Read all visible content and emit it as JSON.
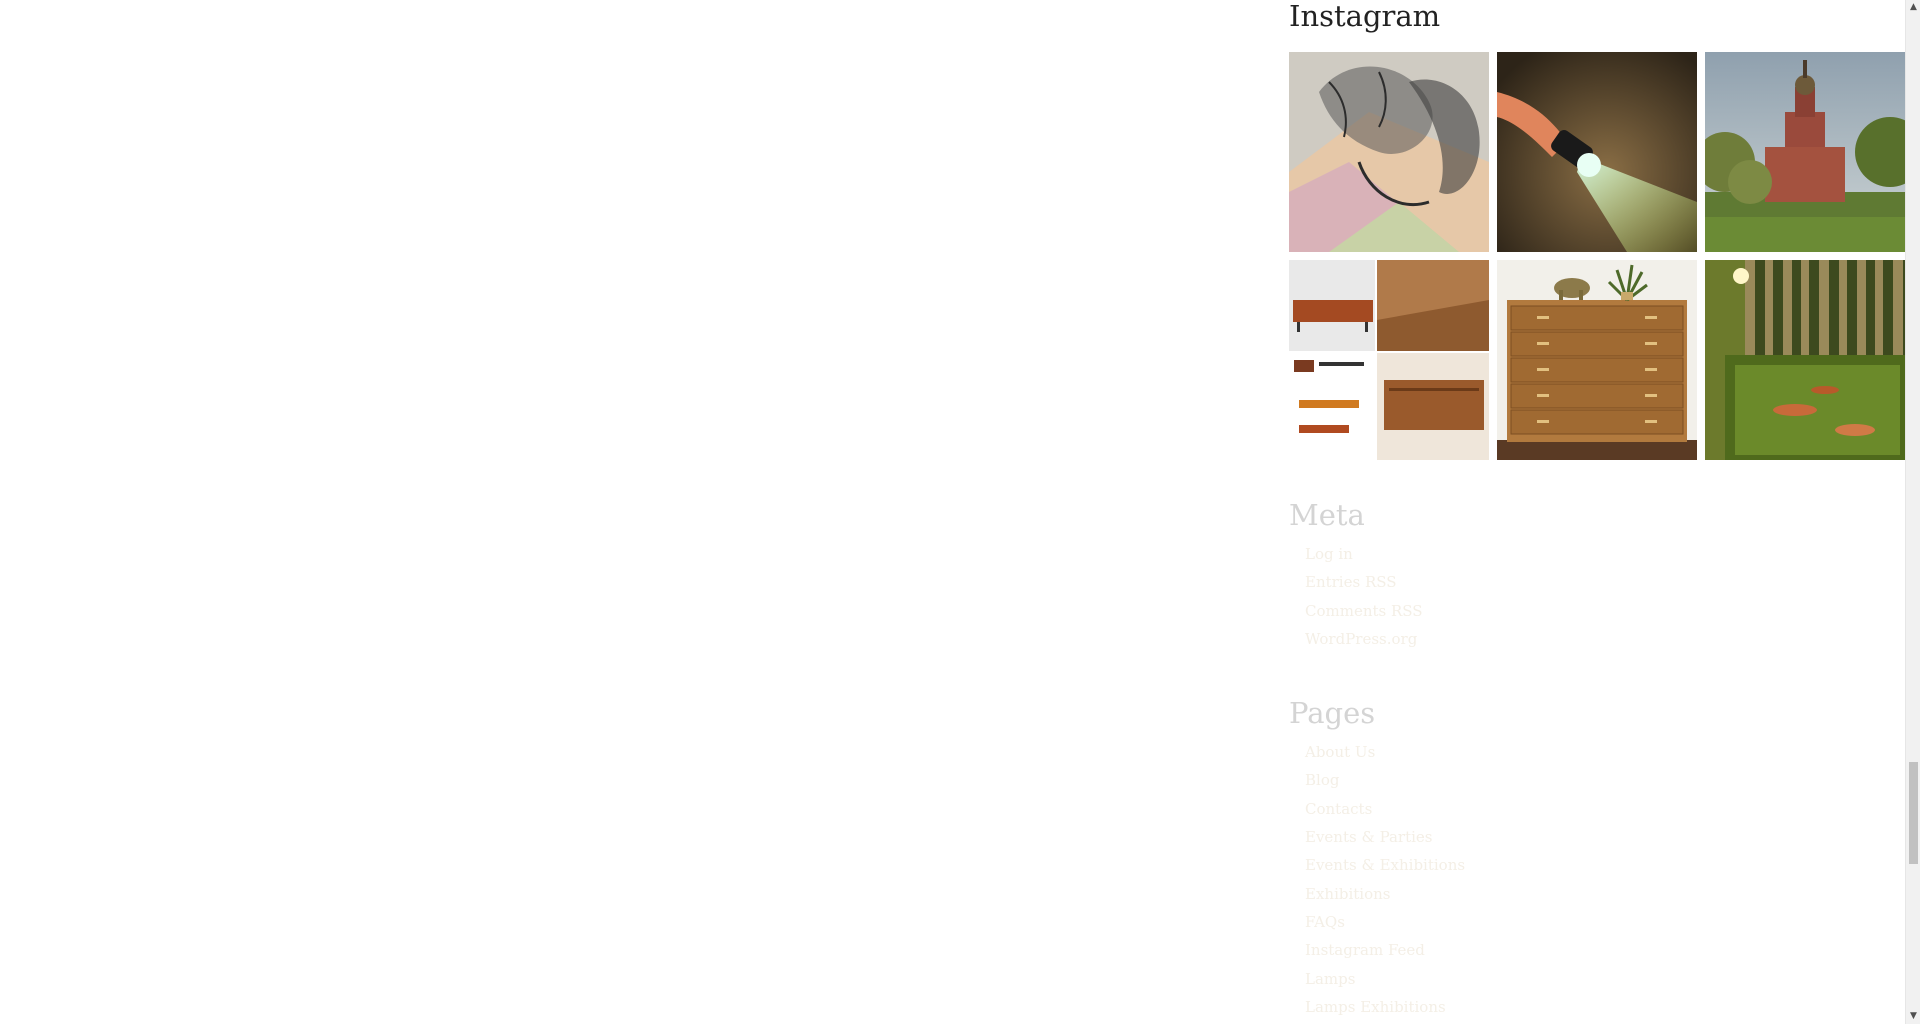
{
  "instagram": {
    "title": "Instagram",
    "tiles": [
      {
        "icon": "illustration-photo-icon"
      },
      {
        "icon": "flashlight-water-photo-icon"
      },
      {
        "icon": "church-photo-icon"
      },
      {
        "icon": "furniture-collage-photo-icon"
      },
      {
        "icon": "dresser-photo-icon"
      },
      {
        "icon": "pond-room-photo-icon"
      }
    ]
  },
  "meta": {
    "title": "Meta",
    "links": [
      "Log in",
      "Entries RSS",
      "Comments RSS",
      "WordPress.org"
    ]
  },
  "pages": {
    "title": "Pages",
    "links": [
      "About Us",
      "Blog",
      "Contacts",
      "Events & Parties",
      "Events & Exhibitions",
      "Exhibitions",
      "FAQs",
      "Instagram Feed",
      "Lamps",
      "Lamps Exhibitions"
    ]
  },
  "colors": {
    "heading": "#222222",
    "faded_heading": "#d4d4d4",
    "faded_link": "#f4efe6",
    "scroll_thumb": "#c1c1c1"
  }
}
